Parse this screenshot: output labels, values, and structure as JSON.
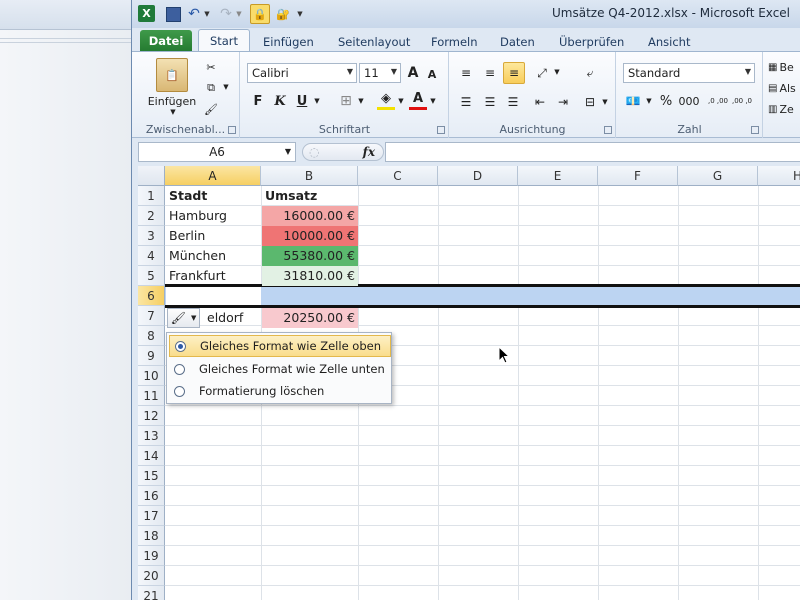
{
  "window": {
    "title": "Umsätze Q4-2012.xlsx  -  Microsoft Excel"
  },
  "qat": {
    "app_icon": "X"
  },
  "tabs": [
    {
      "label": "Datei"
    },
    {
      "label": "Start"
    },
    {
      "label": "Einfügen"
    },
    {
      "label": "Seitenlayout"
    },
    {
      "label": "Formeln"
    },
    {
      "label": "Daten"
    },
    {
      "label": "Überprüfen"
    },
    {
      "label": "Ansicht"
    }
  ],
  "ribbon": {
    "clipboard": {
      "paste_label": "Einfügen",
      "group_label": "Zwischenabl..."
    },
    "font": {
      "family": "Calibri",
      "size": "11",
      "bold": "F",
      "italic": "K",
      "underline": "U",
      "grow": "A",
      "shrink": "A",
      "font_color_letter": "A",
      "group_label": "Schriftart"
    },
    "alignment": {
      "group_label": "Ausrichtung"
    },
    "number": {
      "format": "Standard",
      "percent": "%",
      "thousands": "000",
      "inc_dec": ",0 ,00",
      "dec_dec": ",00 ,0",
      "group_label": "Zahl"
    },
    "styles": {
      "item1": "Be",
      "item2": "Als",
      "item3": "Ze"
    }
  },
  "formula_bar": {
    "name_box": "A6",
    "fx": "fx",
    "content": ""
  },
  "sheet": {
    "columns": [
      "A",
      "B",
      "C",
      "D",
      "E",
      "F",
      "G",
      "H"
    ],
    "rows": [
      "1",
      "2",
      "3",
      "4",
      "5",
      "6",
      "7",
      "8",
      "9",
      "10",
      "11",
      "12",
      "13",
      "14",
      "15",
      "16",
      "17",
      "18",
      "19",
      "20",
      "21"
    ],
    "cells": [
      {
        "row": 1,
        "a": "Stadt",
        "b": "Umsatz"
      },
      {
        "row": 2,
        "a": "Hamburg",
        "b": "16000.00 €",
        "fill": "#f4a6a6"
      },
      {
        "row": 3,
        "a": "Berlin",
        "b": "10000.00 €",
        "fill": "#ef7474"
      },
      {
        "row": 4,
        "a": "München",
        "b": "55380.00 €",
        "fill": "#5bb86e"
      },
      {
        "row": 5,
        "a": "Frankfurt",
        "b": "31810.00 €",
        "fill": "#e2f1e4"
      },
      {
        "row": 7,
        "a": "eldorf",
        "b": "20250.00 €",
        "fill": "#f8c9ce"
      }
    ],
    "selected_row": "6"
  },
  "paste_options": {
    "items": [
      {
        "label": "Gleiches Format wie Zelle oben",
        "selected": true
      },
      {
        "label": "Gleiches Format wie Zelle unten",
        "selected": false
      },
      {
        "label": "Formatierung löschen",
        "selected": false
      }
    ]
  }
}
